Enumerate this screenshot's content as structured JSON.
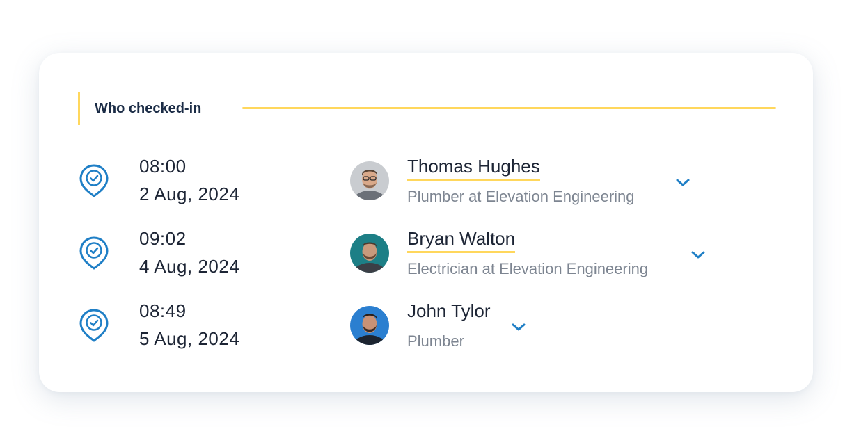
{
  "section": {
    "title": "Who checked-in"
  },
  "checkins": [
    {
      "time": "08:00",
      "date": "2 Aug, 2024",
      "name": "Thomas Hughes",
      "role": "Plumber at Elevation Engineering",
      "icon": "location-check-icon"
    },
    {
      "time": "09:02",
      "date": "4 Aug, 2024",
      "name": "Bryan Walton",
      "role": "Electrician at Elevation Engineering",
      "icon": "location-check-icon"
    },
    {
      "time": "08:49",
      "date": "5 Aug, 2024",
      "name": "John Tylor",
      "role": "Plumber",
      "icon": "location-check-icon"
    }
  ],
  "colors": {
    "accent_yellow": "#ffd75c",
    "accent_blue": "#1f7fc6",
    "text_dark": "#1d2535",
    "text_muted": "#7d8591"
  }
}
